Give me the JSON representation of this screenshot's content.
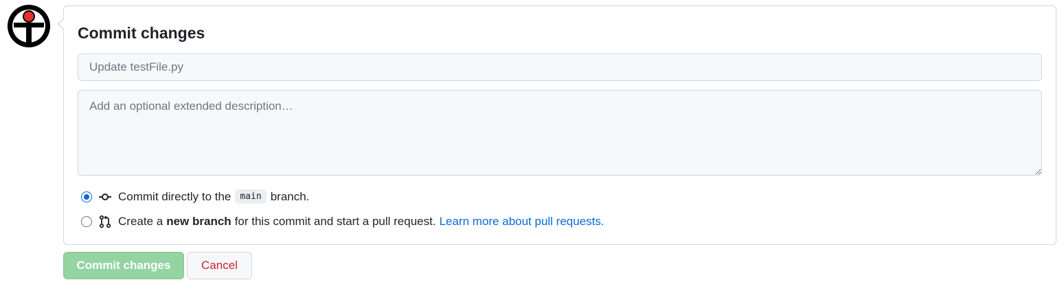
{
  "commit_form": {
    "title": "Commit changes",
    "summary": {
      "placeholder": "Update testFile.py",
      "value": ""
    },
    "description": {
      "placeholder": "Add an optional extended description…",
      "value": ""
    },
    "options": {
      "direct": {
        "checked": true,
        "icon": "git-commit-icon",
        "prefix": "Commit directly to the",
        "branch": "main",
        "suffix": "branch."
      },
      "new_branch": {
        "checked": false,
        "icon": "git-pull-request-icon",
        "prefix": "Create a",
        "bold": "new branch",
        "suffix": "for this commit and start a pull request.",
        "link": "Learn more about pull requests."
      }
    }
  },
  "actions": {
    "commit_label": "Commit changes",
    "cancel_label": "Cancel"
  },
  "colors": {
    "accent": "#0969da",
    "commit_button_disabled": "#94d3a2",
    "cancel_text": "#cf222e",
    "avatar_red": "#e5302b"
  }
}
